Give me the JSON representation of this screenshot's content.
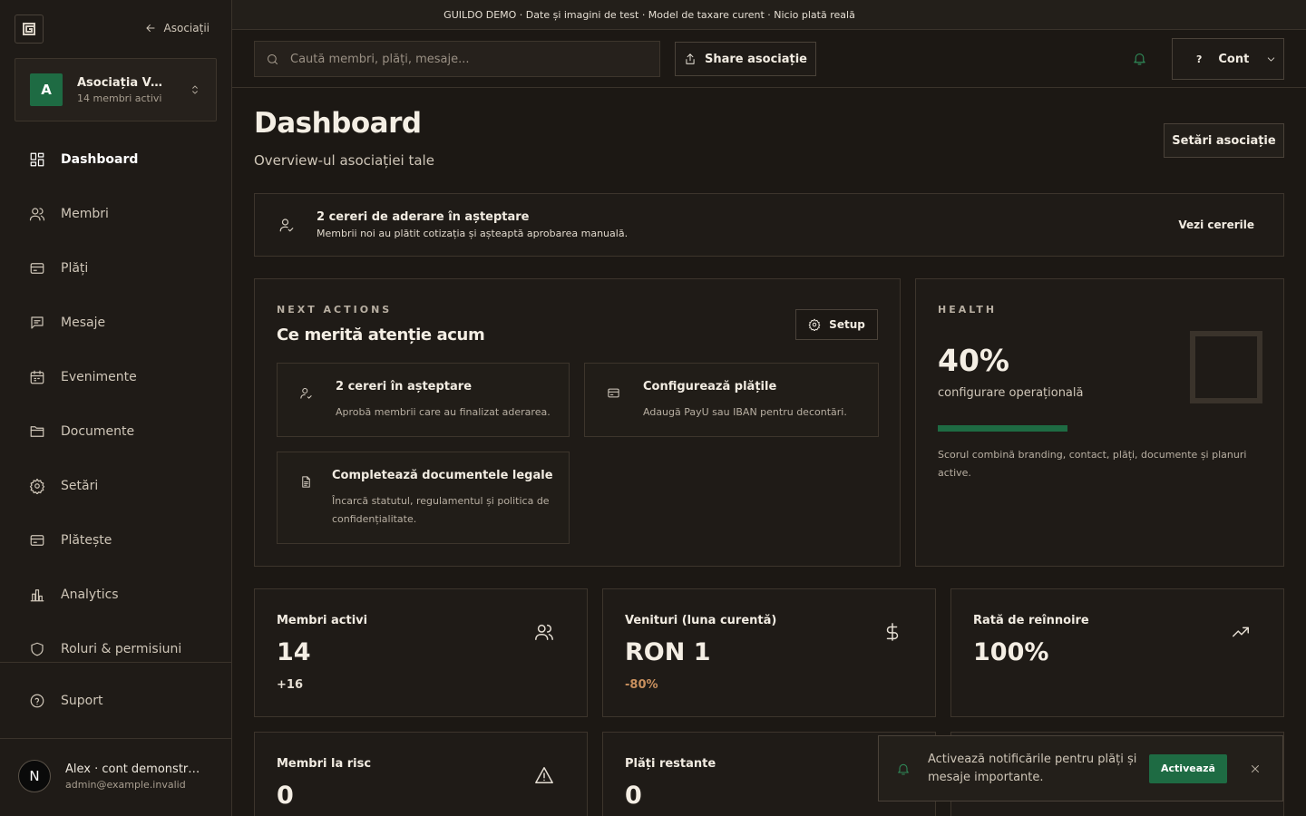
{
  "banner": {
    "text": "GUILDO DEMO · Date și imagini de test · Model de taxare curent · Nicio plată reală"
  },
  "sidebar": {
    "back_label": "Asociații",
    "org": {
      "initial": "A",
      "name": "Asociația Verde",
      "members": "14 membri activi"
    },
    "items": [
      {
        "label": "Dashboard"
      },
      {
        "label": "Membri"
      },
      {
        "label": "Plăți"
      },
      {
        "label": "Mesaje"
      },
      {
        "label": "Evenimente"
      },
      {
        "label": "Documente"
      },
      {
        "label": "Setări"
      },
      {
        "label": "Plătește"
      },
      {
        "label": "Analytics"
      },
      {
        "label": "Roluri & permisiuni"
      }
    ],
    "support_label": "Suport",
    "user": {
      "initial": "N",
      "name": "Alex · cont demonstrativ",
      "email": "admin@example.invalid"
    }
  },
  "topbar": {
    "search_placeholder": "Caută membri, plăți, mesaje...",
    "share_label": "Share asociație",
    "account_help": "?",
    "account_label": "Cont"
  },
  "page": {
    "title": "Dashboard",
    "subtitle": "Overview-ul asociației tale",
    "settings_label": "Setări asociație"
  },
  "alert": {
    "title": "2 cereri de aderare în așteptare",
    "subtitle": "Membrii noi au plătit cotizația și așteaptă aprobarea manuală.",
    "link": "Vezi cererile"
  },
  "next_actions": {
    "eyebrow": "NEXT ACTIONS",
    "title": "Ce merită atenție acum",
    "setup_label": "Setup",
    "tasks": [
      {
        "title": "2 cereri în așteptare",
        "subtitle": "Aprobă membrii care au finalizat aderarea."
      },
      {
        "title": "Configurează plățile",
        "subtitle": "Adaugă PayU sau IBAN pentru decontări."
      },
      {
        "title": "Completează documentele legale",
        "subtitle": "Încarcă statutul, regulamentul și politica de confidențialitate."
      }
    ]
  },
  "health": {
    "eyebrow": "HEALTH",
    "value": "40%",
    "progress": 0.4,
    "label": "configurare operațională",
    "description": "Scorul combină branding, contact, plăți, documente și planuri active."
  },
  "stats": [
    {
      "label": "Membri activi",
      "value": "14",
      "delta": "+16",
      "icon": "users-icon"
    },
    {
      "label": "Venituri (luna curentă)",
      "value": "RON 1",
      "delta": "-80%",
      "icon": "dollar-icon"
    },
    {
      "label": "Rată de reînnoire",
      "value": "100%",
      "delta": "",
      "icon": "trending-up-icon"
    },
    {
      "label": "Membri la risc",
      "value": "0",
      "icon": "warning-icon"
    },
    {
      "label": "Plăți restante",
      "value": "0"
    }
  ],
  "colors": {
    "accent": "#1e6b43",
    "positive_delta": "#e6dfd4",
    "negative_delta": "#c9905e"
  },
  "toast": {
    "text": "Activează notificările pentru plăți și mesaje importante.",
    "button_label": "Activează"
  }
}
